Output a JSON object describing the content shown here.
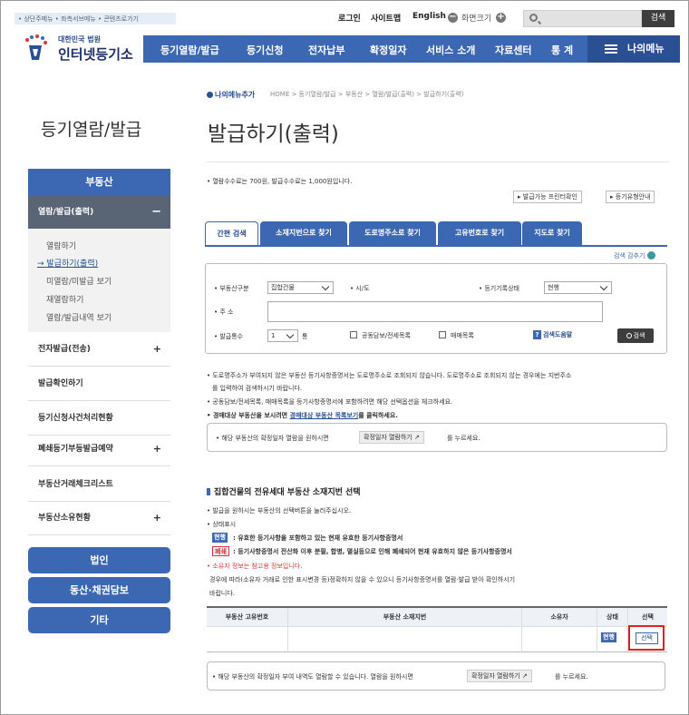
{
  "header": {
    "skip_nav": "• 상단주메뉴 • 좌측서브메뉴 • 콘텐츠로가기",
    "login": "로그인",
    "sitemap": "사이트맵",
    "english": "English",
    "zoom_label": "화면크기",
    "zoom_out": "−",
    "zoom_in": "+",
    "search_placeholder": "",
    "search_button": "검색",
    "logo_line1": "대한민국 법원",
    "logo_line2": "인터넷등기소",
    "gnb": [
      "등기열람/발급",
      "등기신청",
      "전자납부",
      "확정일자",
      "서비스 소개",
      "자료센터",
      "통 계"
    ],
    "my_menu": "나의메뉴"
  },
  "sidebar": {
    "title": "등기열람/발급",
    "category": "부동산",
    "open_item": "열람/발급(출력)",
    "open_toggle": "−",
    "sub_items": [
      "열람하기",
      "발급하기(출력)",
      "미열람/미발급 보기",
      "재열람하기",
      "열람/발급내역 보기"
    ],
    "active_marker": "→",
    "items": [
      {
        "label": "전자발급(전송)",
        "toggle": "+"
      },
      {
        "label": "발급확인하기",
        "toggle": ""
      },
      {
        "label": "등기신청사건처리현황",
        "toggle": ""
      },
      {
        "label": "폐쇄등기부등발급예약",
        "toggle": "+"
      },
      {
        "label": "부동산거래체크리스트",
        "toggle": ""
      },
      {
        "label": "부동산소유현황",
        "toggle": "+"
      }
    ],
    "big_buttons": [
      "법인",
      "동산·채권담보",
      "기타"
    ]
  },
  "content": {
    "my_menu_add": "나의메뉴추가",
    "breadcrumb": "HOME > 등기열람/발급 > 부동산 > 열람/발급(출력) > 발급하기(출력)",
    "title": "발급하기(출력)",
    "fee_note": "열람수수료는 700원, 발급수수료는 1,000원입니다.",
    "link_printer": "발급가능 프린터확인",
    "link_type_guide": "등기유형안내",
    "tabs": [
      "간편 검색",
      "소재지번으로 찾기",
      "도로명주소로 찾기",
      "고유번호로 찾기",
      "지도로 찾기"
    ],
    "fold_search": "검색 감추기",
    "form": {
      "type_label": "부동산구분",
      "type_value": "집합건물",
      "sido_label": "시/도",
      "status_label": "등기기록상태",
      "status_value": "현행",
      "address_label": "주 소",
      "address_value": "",
      "count_label": "발급통수",
      "count_value": "1",
      "count_unit": "통",
      "check1": "공동담보/전세목록",
      "check2": "매매목록",
      "help_button": "검색도움말",
      "help_icon": "?",
      "search_button": "검색"
    },
    "notes": [
      "도로명주소가 부여되지 않은 부동산 등기사항증명서는 도로명주소로 조회되지 않습니다. 도로명주소로 조회되지 않는 경우에는 지번주소",
      "를 입력하여 검색하시기 바랍니다.",
      "공동담보/전세목록, 매매목록을 등기사항증명서에 포함하려면 해당 선택옵션을 체크하세요.",
      "경매대상 부동산을 보시려면 ",
      "경매대상 부동산 목록보기",
      "를 클릭하세요."
    ],
    "info1_pre": "해당 부동산의 확정일자 열람을 원하시면",
    "info1_button": "확정일자 열람하기",
    "info1_post": "를 누르세요.",
    "section_title": "집합건물의 전유세대 부동산 소재지번 선택",
    "sec_notes": [
      "발급을 원하시는 부동산의 선택버튼을 눌러주십시오.",
      "상태표시"
    ],
    "badge_current": "현행",
    "badge_current_desc": ": 유효한 등기사항을 포함하고 있는 현재 유효한 등기사항증명서",
    "badge_closed": "폐쇄",
    "badge_closed_desc": ": 등기사항증명서 전산화 이후 분필, 합병, 멸실등으로 인해 폐쇄되어 현재 유효하지 않은 등기사항증명서",
    "owner_note1": "소유자 정보는 참고용 정보입니다.",
    "owner_note2": "경우에 따라(소유자 거래로 인한 표시변경 등)정확하지 않을 수 있으니 등기사항증명서를 열람·발급 받아 확인하시기",
    "owner_note3": "바랍니다.",
    "table": {
      "headers": [
        "부동산 고유번호",
        "부동산 소재지번",
        "소유자",
        "상태",
        "선택"
      ],
      "rows": [
        {
          "id": "",
          "address": "",
          "owner": "",
          "status": "현행",
          "select": "선택"
        }
      ]
    },
    "info2_pre": "해당 부동산의 확정일자 부여 내역도 열람할 수 있습니다. 열람을 원하시면",
    "info2_button": "확정일자 열람하기",
    "info2_post": "를 누르세요."
  },
  "colors": {
    "primary": "#3c67b3",
    "dark": "#2a4f92",
    "highlight": "#e02020"
  }
}
